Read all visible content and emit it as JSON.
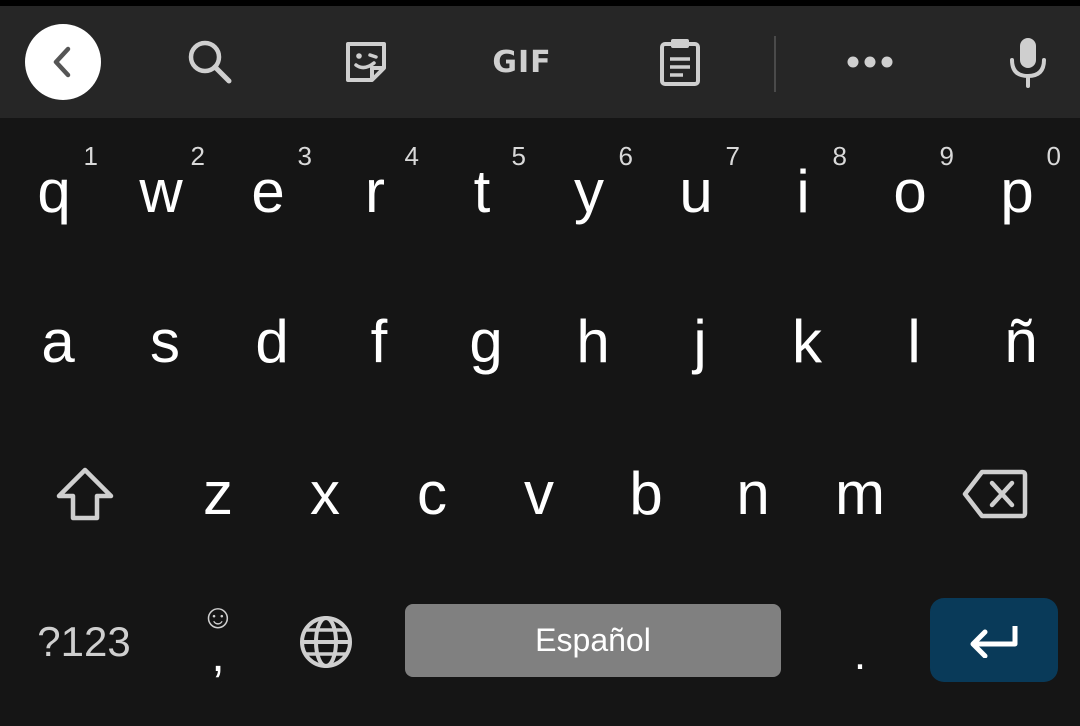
{
  "toolbar": {
    "back_icon": "chevron-left-icon",
    "items": [
      {
        "name": "search",
        "icon": "search-icon"
      },
      {
        "name": "sticker",
        "icon": "sticker-icon"
      },
      {
        "name": "gif",
        "label": "GIF"
      },
      {
        "name": "clipboard",
        "icon": "clipboard-icon"
      },
      {
        "name": "more",
        "icon": "more-horizontal-icon"
      },
      {
        "name": "voice",
        "icon": "microphone-icon"
      }
    ]
  },
  "rows": {
    "row1": [
      {
        "letter": "q",
        "hint": "1"
      },
      {
        "letter": "w",
        "hint": "2"
      },
      {
        "letter": "e",
        "hint": "3"
      },
      {
        "letter": "r",
        "hint": "4"
      },
      {
        "letter": "t",
        "hint": "5"
      },
      {
        "letter": "y",
        "hint": "6"
      },
      {
        "letter": "u",
        "hint": "7"
      },
      {
        "letter": "i",
        "hint": "8"
      },
      {
        "letter": "o",
        "hint": "9"
      },
      {
        "letter": "p",
        "hint": "0"
      }
    ],
    "row2": [
      "a",
      "s",
      "d",
      "f",
      "g",
      "h",
      "j",
      "k",
      "l",
      "ñ"
    ],
    "row3": [
      "z",
      "x",
      "c",
      "v",
      "b",
      "n",
      "m"
    ]
  },
  "bottom": {
    "symbols_label": "?123",
    "comma_label": ",",
    "emoji_hint": "☺",
    "space_label": "Español",
    "period_label": "."
  },
  "colors": {
    "background": "#151515",
    "toolbar": "#262626",
    "space_key": "#808080",
    "enter_key": "#093a59",
    "icon": "#cfcfcf"
  }
}
